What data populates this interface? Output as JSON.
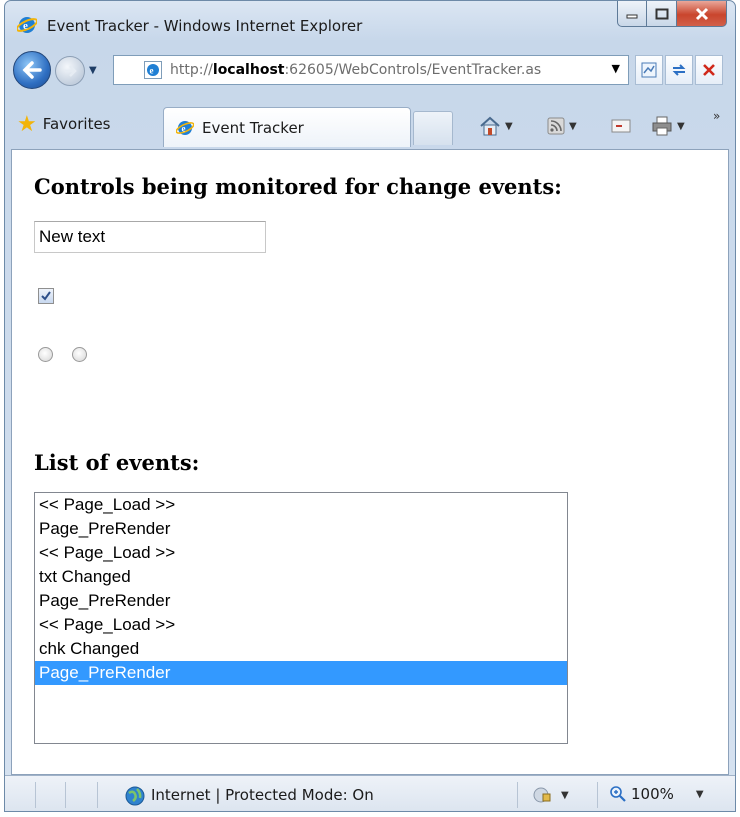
{
  "window": {
    "title": "Event Tracker - Windows Internet Explorer",
    "address_prefix": "http://",
    "address_host": "localhost",
    "address_rest": ":62605/WebControls/EventTracker.as"
  },
  "toolbar": {
    "favorites_label": "Favorites",
    "tab_label": "Event Tracker"
  },
  "page": {
    "heading_controls": "Controls being monitored for change events:",
    "textbox_value": "New text",
    "checkbox_checked": true,
    "heading_events": "List of events:",
    "events": [
      "<< Page_Load >>",
      "Page_PreRender",
      "<< Page_Load >>",
      "txt Changed",
      "Page_PreRender",
      "<< Page_Load >>",
      "chk Changed",
      "Page_PreRender"
    ],
    "selected_event_index": 7
  },
  "status": {
    "zone_text": "Internet | Protected Mode: On",
    "zoom": "100%"
  },
  "colors": {
    "selection": "#3399ff"
  }
}
